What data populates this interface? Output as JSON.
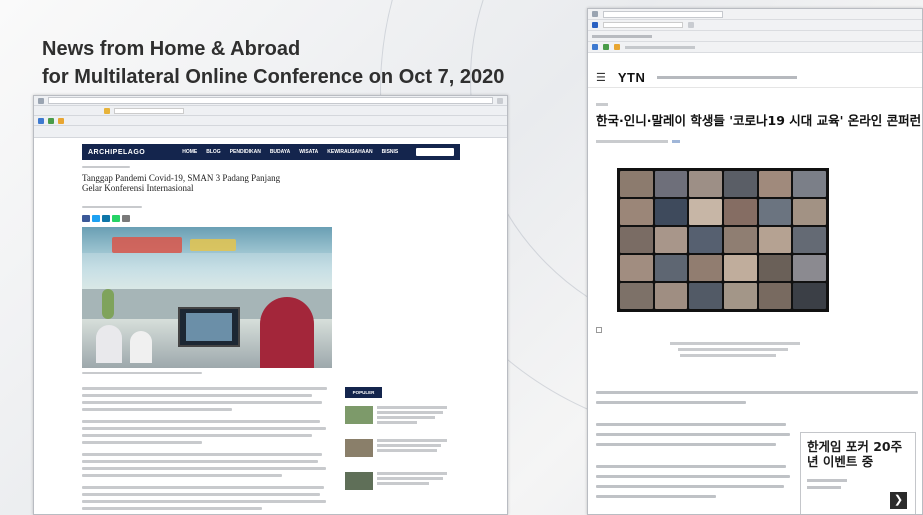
{
  "slide": {
    "title_line1": "News from Home & Abroad",
    "title_line2": "for Multilateral Online Conference on Oct 7, 2020"
  },
  "left_article": {
    "site_logo": "ARCHIPELAGO",
    "nav_items": [
      "HOME",
      "BLOG",
      "PENDIDIKAN",
      "BUDAYA",
      "WISATA",
      "KEWIRAUSAHAAN",
      "BISNIS"
    ],
    "headline": "Tanggap Pandemi Covid-19, SMAN 3 Padang Panjang Gelar Konferensi Internasional",
    "sidebar_heading": "POPULER"
  },
  "right_article": {
    "site_logo": "YTN",
    "headline": "한국·인니·말레이 학생들 '코로나19 시대 교육' 온라인 콘퍼런",
    "ad_title": "한게임 포커 20주년 이벤트 중",
    "ad_arrow_icon": "chevron-right-icon"
  },
  "colors": {
    "nav_dark": "#14254d",
    "title_text": "#2f2f2f"
  }
}
